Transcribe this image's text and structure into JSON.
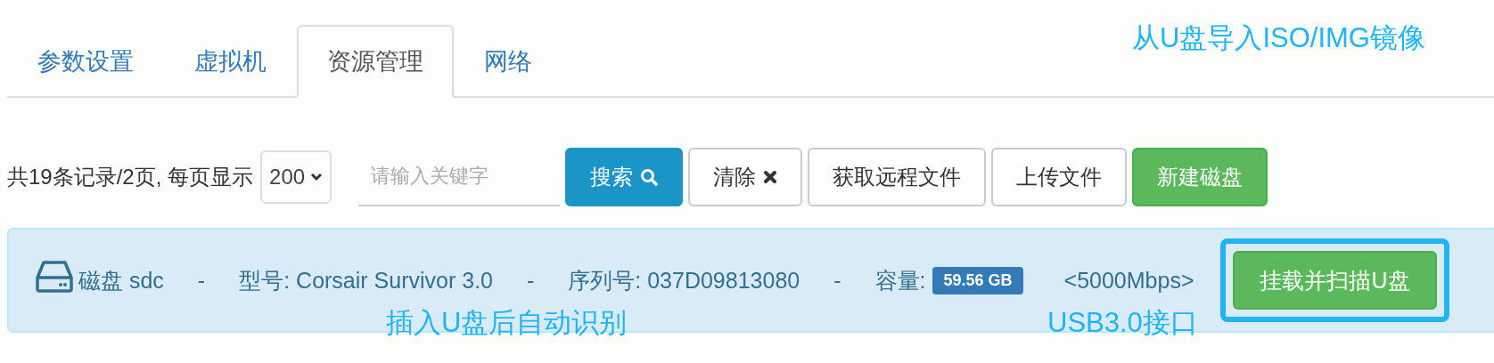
{
  "tabs": [
    {
      "label": "参数设置",
      "selected": false
    },
    {
      "label": "虚拟机",
      "selected": false
    },
    {
      "label": "资源管理",
      "selected": true
    },
    {
      "label": "网络",
      "selected": false
    }
  ],
  "toolbar": {
    "summary": "共19条记录/2页, 每页显示",
    "page_size": "200",
    "search": {
      "placeholder": "请输入关键字"
    },
    "buttons": [
      {
        "label": "搜索",
        "kind": "search"
      },
      {
        "label": "清除",
        "kind": "clear"
      },
      {
        "label": "获取远程文件",
        "kind": "default"
      },
      {
        "label": "上传文件",
        "kind": "default"
      },
      {
        "label": "新建磁盘",
        "kind": "success"
      }
    ]
  },
  "disk": {
    "name": "磁盘 sdc",
    "separator_1": "-",
    "model": "型号: Corsair Survivor 3.0",
    "separator_2": "-",
    "serial": "序列号: 037D09813080",
    "separator_3": "-",
    "capacity_label": "容量:",
    "capacity": "59.56 GB",
    "speed": "<5000Mbps>",
    "button": "挂载并扫描U盘",
    "highlighted": true
  },
  "annotations": [
    {
      "text": "从U盘导入ISO/IMG镜像",
      "kind": "top"
    },
    {
      "text": "插入U盘后自动识别",
      "kind": "disk"
    },
    {
      "text": "USB3.0接口",
      "kind": "port"
    }
  ]
}
